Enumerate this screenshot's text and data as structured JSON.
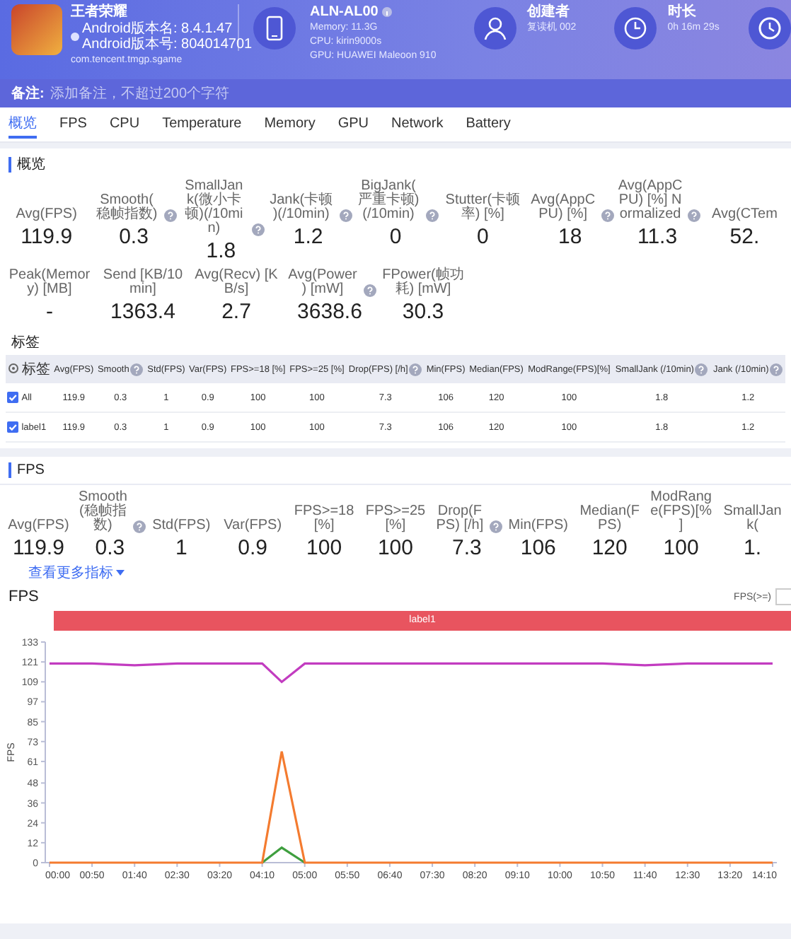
{
  "header": {
    "app": {
      "name": "王者荣耀",
      "version_name": "Android版本名: 8.4.1.47",
      "version_code": "Android版本号: 804014701",
      "package": "com.tencent.tmgp.sgame"
    },
    "device": {
      "model": "ALN-AL00",
      "memory": "Memory: 11.3G",
      "cpu": "CPU: kirin9000s",
      "gpu": "GPU: HUAWEI Maleoon 910"
    },
    "creator": {
      "label": "创建者",
      "value": "复读机 002"
    },
    "duration": {
      "label": "时长",
      "value": "0h 16m 29s"
    }
  },
  "notes": {
    "label": "备注:",
    "placeholder": "添加备注，不超过200个字符"
  },
  "tabs": [
    {
      "label": "概览",
      "selected": true
    },
    {
      "label": "FPS",
      "selected": false
    },
    {
      "label": "CPU",
      "selected": false
    },
    {
      "label": "Temperature",
      "selected": false
    },
    {
      "label": "Memory",
      "selected": false
    },
    {
      "label": "GPU",
      "selected": false
    },
    {
      "label": "Network",
      "selected": false
    },
    {
      "label": "Battery",
      "selected": false
    }
  ],
  "overview": {
    "title": "概览",
    "stats_row_1": [
      {
        "label": "Avg(FPS)",
        "value": "119.9",
        "help": false
      },
      {
        "label": "Smooth(稳帧指数)",
        "value": "0.3",
        "help": true
      },
      {
        "label": "SmallJank(微小卡顿)(/10min)",
        "value": "1.8",
        "help": true
      },
      {
        "label": "Jank(卡顿)(/10min)",
        "value": "1.2",
        "help": true
      },
      {
        "label": "BigJank(严重卡顿)(/10min)",
        "value": "0",
        "help": true
      },
      {
        "label": "Stutter(卡顿率) [%]",
        "value": "0",
        "help": false
      },
      {
        "label": "Avg(AppCPU) [%]",
        "value": "18",
        "help": true
      },
      {
        "label": "Avg(AppCPU) [%] Normalized",
        "value": "11.3",
        "help": true
      },
      {
        "label": "Avg(CTem",
        "value": "52.",
        "help": false
      }
    ],
    "stats_row_2": [
      {
        "label": "Peak(Memory) [MB]",
        "value": "-",
        "help": false
      },
      {
        "label": "Send [KB/10min]",
        "value": "1363.4",
        "help": false
      },
      {
        "label": "Avg(Recv) [KB/s]",
        "value": "2.7",
        "help": false
      },
      {
        "label": "Avg(Power) [mW]",
        "value": "3638.6",
        "help": true
      },
      {
        "label": "FPower(帧功耗) [mW]",
        "value": "30.3",
        "help": false
      }
    ],
    "labels_table": {
      "title": "标签",
      "columns": [
        {
          "label": "标签",
          "help": false
        },
        {
          "label": "Avg(FPS)",
          "help": false
        },
        {
          "label": "Smooth",
          "help": true
        },
        {
          "label": "Std(FPS)",
          "help": false
        },
        {
          "label": "Var(FPS)",
          "help": false
        },
        {
          "label": "FPS>=18 [%]",
          "help": false
        },
        {
          "label": "FPS>=25 [%]",
          "help": false
        },
        {
          "label": "Drop(FPS) [/h]",
          "help": true
        },
        {
          "label": "Min(FPS)",
          "help": false
        },
        {
          "label": "Median(FPS)",
          "help": false
        },
        {
          "label": "ModRange(FPS)[%]",
          "help": false
        },
        {
          "label": "SmallJank (/10min)",
          "help": true
        },
        {
          "label": "Jank (/10min)",
          "help": true
        }
      ],
      "rows": [
        {
          "checked": true,
          "cells": [
            "All",
            "119.9",
            "0.3",
            "1",
            "0.9",
            "100",
            "100",
            "7.3",
            "106",
            "120",
            "100",
            "1.8",
            "1.2"
          ]
        },
        {
          "checked": true,
          "cells": [
            "label1",
            "119.9",
            "0.3",
            "1",
            "0.9",
            "100",
            "100",
            "7.3",
            "106",
            "120",
            "100",
            "1.8",
            "1.2"
          ]
        }
      ]
    }
  },
  "fps": {
    "title": "FPS",
    "stats": [
      {
        "label": "Avg(FPS)",
        "value": "119.9",
        "help": false
      },
      {
        "label": "Smooth(稳帧指数)",
        "value": "0.3",
        "help": true
      },
      {
        "label": "Std(FPS)",
        "value": "1",
        "help": false
      },
      {
        "label": "Var(FPS)",
        "value": "0.9",
        "help": false
      },
      {
        "label": "FPS>=18 [%]",
        "value": "100",
        "help": false
      },
      {
        "label": "FPS>=25 [%]",
        "value": "100",
        "help": false
      },
      {
        "label": "Drop(FPS) [/h]",
        "value": "7.3",
        "help": true
      },
      {
        "label": "Min(FPS)",
        "value": "106",
        "help": false
      },
      {
        "label": "Median(FPS)",
        "value": "120",
        "help": false
      },
      {
        "label": "ModRange(FPS)[%]",
        "value": "100",
        "help": false
      },
      {
        "label": "SmallJank(",
        "value": "1.",
        "help": false
      }
    ],
    "more_link": "查看更多指标",
    "chart": {
      "title": "FPS",
      "threshold_label": "FPS(>=)",
      "label_band": "label1",
      "chart_data": {
        "type": "line",
        "ylabel": "FPS",
        "x": [
          0,
          50,
          100,
          150,
          200,
          250,
          273,
          300,
          350,
          400,
          450,
          500,
          550,
          600,
          650,
          700,
          750,
          800,
          850
        ],
        "series": [
          {
            "color": "#c23cc0",
            "values": [
              120,
              120,
              119,
              120,
              120,
              120,
              109,
              120,
              120,
              120,
              120,
              120,
              120,
              120,
              120,
              119,
              120,
              120,
              120
            ]
          },
          {
            "color": "#f47b2f",
            "values": [
              0,
              0,
              0,
              0,
              0,
              0,
              67,
              0,
              0,
              0,
              0,
              0,
              0,
              0,
              0,
              0,
              0,
              0,
              0
            ]
          },
          {
            "color": "#3f9f3f",
            "values": [
              null,
              null,
              null,
              null,
              null,
              0,
              9,
              0,
              null,
              null,
              null,
              null,
              null,
              null,
              null,
              null,
              null,
              null,
              null
            ]
          }
        ],
        "xlim": [
          0,
          850
        ],
        "ylim": [
          0,
          133
        ],
        "xticks": [
          {
            "value": 0,
            "label": "00:00"
          },
          {
            "value": 50,
            "label": "00:50"
          },
          {
            "value": 100,
            "label": "01:40"
          },
          {
            "value": 150,
            "label": "02:30"
          },
          {
            "value": 200,
            "label": "03:20"
          },
          {
            "value": 250,
            "label": "04:10"
          },
          {
            "value": 300,
            "label": "05:00"
          },
          {
            "value": 350,
            "label": "05:50"
          },
          {
            "value": 400,
            "label": "06:40"
          },
          {
            "value": 450,
            "label": "07:30"
          },
          {
            "value": 500,
            "label": "08:20"
          },
          {
            "value": 550,
            "label": "09:10"
          },
          {
            "value": 600,
            "label": "10:00"
          },
          {
            "value": 650,
            "label": "10:50"
          },
          {
            "value": 700,
            "label": "11:40"
          },
          {
            "value": 750,
            "label": "12:30"
          },
          {
            "value": 800,
            "label": "13:20"
          },
          {
            "value": 850,
            "label": "14:10"
          }
        ],
        "yticks": [
          0,
          12,
          24,
          36,
          48,
          61,
          73,
          85,
          97,
          109,
          121,
          133
        ]
      }
    }
  }
}
